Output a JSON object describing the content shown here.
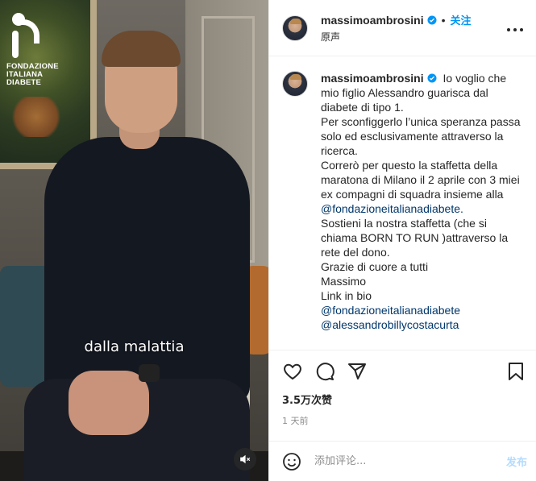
{
  "video": {
    "subtitle": "dalla malattia",
    "logo_lines": [
      "FONDAZIONE",
      "ITALIANA",
      "DIABETE"
    ],
    "mute_icon": "speaker-muted-icon"
  },
  "header": {
    "username": "massimoambrosini",
    "separator": "•",
    "follow_label": "关注",
    "audio_label": "原声",
    "more_icon": "more-options-icon"
  },
  "caption": {
    "username": "massimoambrosini",
    "lines": [
      "Io voglio che mio figlio Alessandro guarisca dal diabete di tipo 1.",
      "Per sconfiggerlo l’unica speranza passa solo ed esclusivamente attraverso la ricerca.",
      "Correrò per questo la staffetta della maratona di Milano il 2 aprile con 3 miei ex compagni di squadra insieme alla"
    ],
    "mention1": "@fondazioneitalianadiabete.",
    "lines2": [
      "Sostieni la nostra staffetta (che si chiama BORN TO RUN )attraverso la rete del dono.",
      "Grazie di cuore a tutti",
      "Massimo",
      "Link in bio"
    ],
    "mention2": "@fondazioneitalianadiabete",
    "mention3": "@alessandrobillycostacurta"
  },
  "stats": {
    "views": "3.5万次赞",
    "time_ago": "1 天前"
  },
  "comment": {
    "placeholder": "添加评论...",
    "post_label": "发布"
  },
  "colors": {
    "accent": "#0095f6",
    "mention": "#00376b",
    "post_disabled": "#b3dbff"
  }
}
